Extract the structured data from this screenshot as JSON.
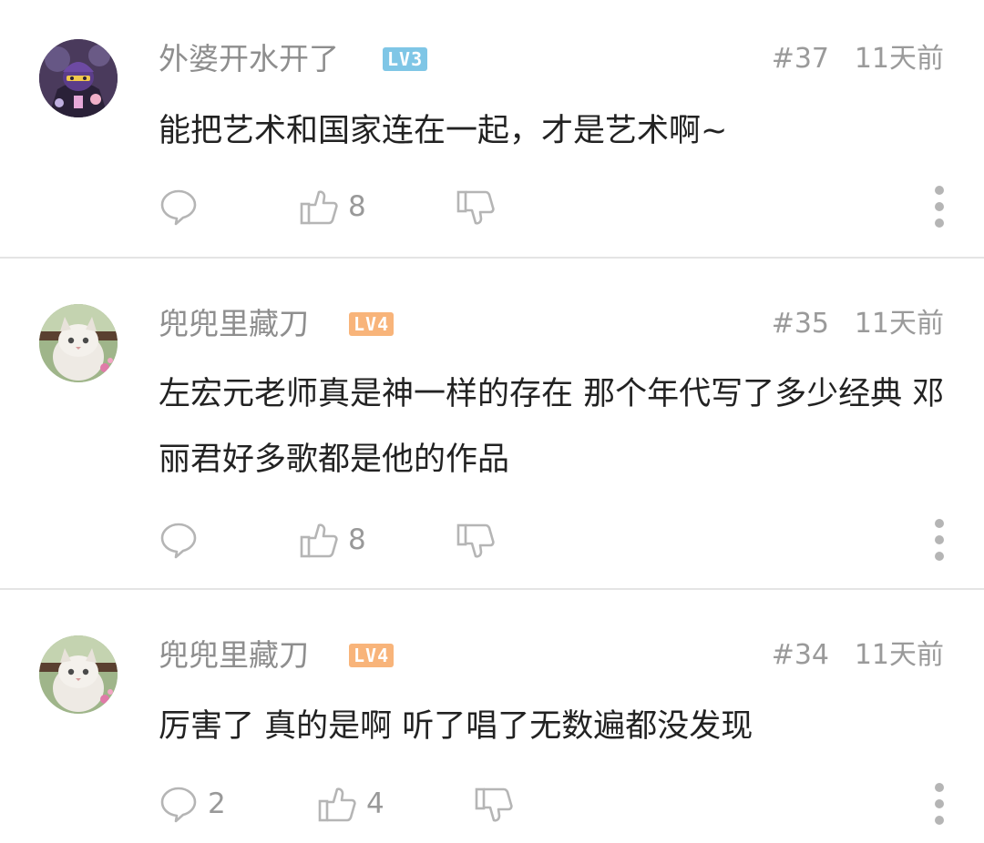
{
  "comments": [
    {
      "username": "外婆开水开了",
      "level": "LV3",
      "level_color": "#7fc6e6",
      "floor": "#37",
      "time": "11天前",
      "content": "能把艺术和国家连在一起，才是艺术啊~",
      "reply_count": "",
      "like_count": "8",
      "avatar_icon": "purple-cartoon-character-avatar"
    },
    {
      "username": "兜兜里藏刀",
      "level": "LV4",
      "level_color": "#f8b47a",
      "floor": "#35",
      "time": "11天前",
      "content": "左宏元老师真是神一样的存在 那个年代写了多少经典 邓丽君好多歌都是他的作品",
      "reply_count": "",
      "like_count": "8",
      "avatar_icon": "kitten-photo-avatar"
    },
    {
      "username": "兜兜里藏刀",
      "level": "LV4",
      "level_color": "#f8b47a",
      "floor": "#34",
      "time": "11天前",
      "content": "厉害了 真的是啊 听了唱了无数遍都没发现",
      "reply_count": "2",
      "like_count": "4",
      "avatar_icon": "kitten-photo-avatar"
    }
  ],
  "icons": {
    "reply": "speech-bubble-icon",
    "like": "thumbs-up-icon",
    "dislike": "thumbs-down-icon",
    "more": "vertical-dots-icon"
  },
  "colors": {
    "icon_gray": "#b5b5b5",
    "text_gray": "#8e8e8e",
    "content_text": "#222222",
    "divider": "#e4e4e4"
  }
}
